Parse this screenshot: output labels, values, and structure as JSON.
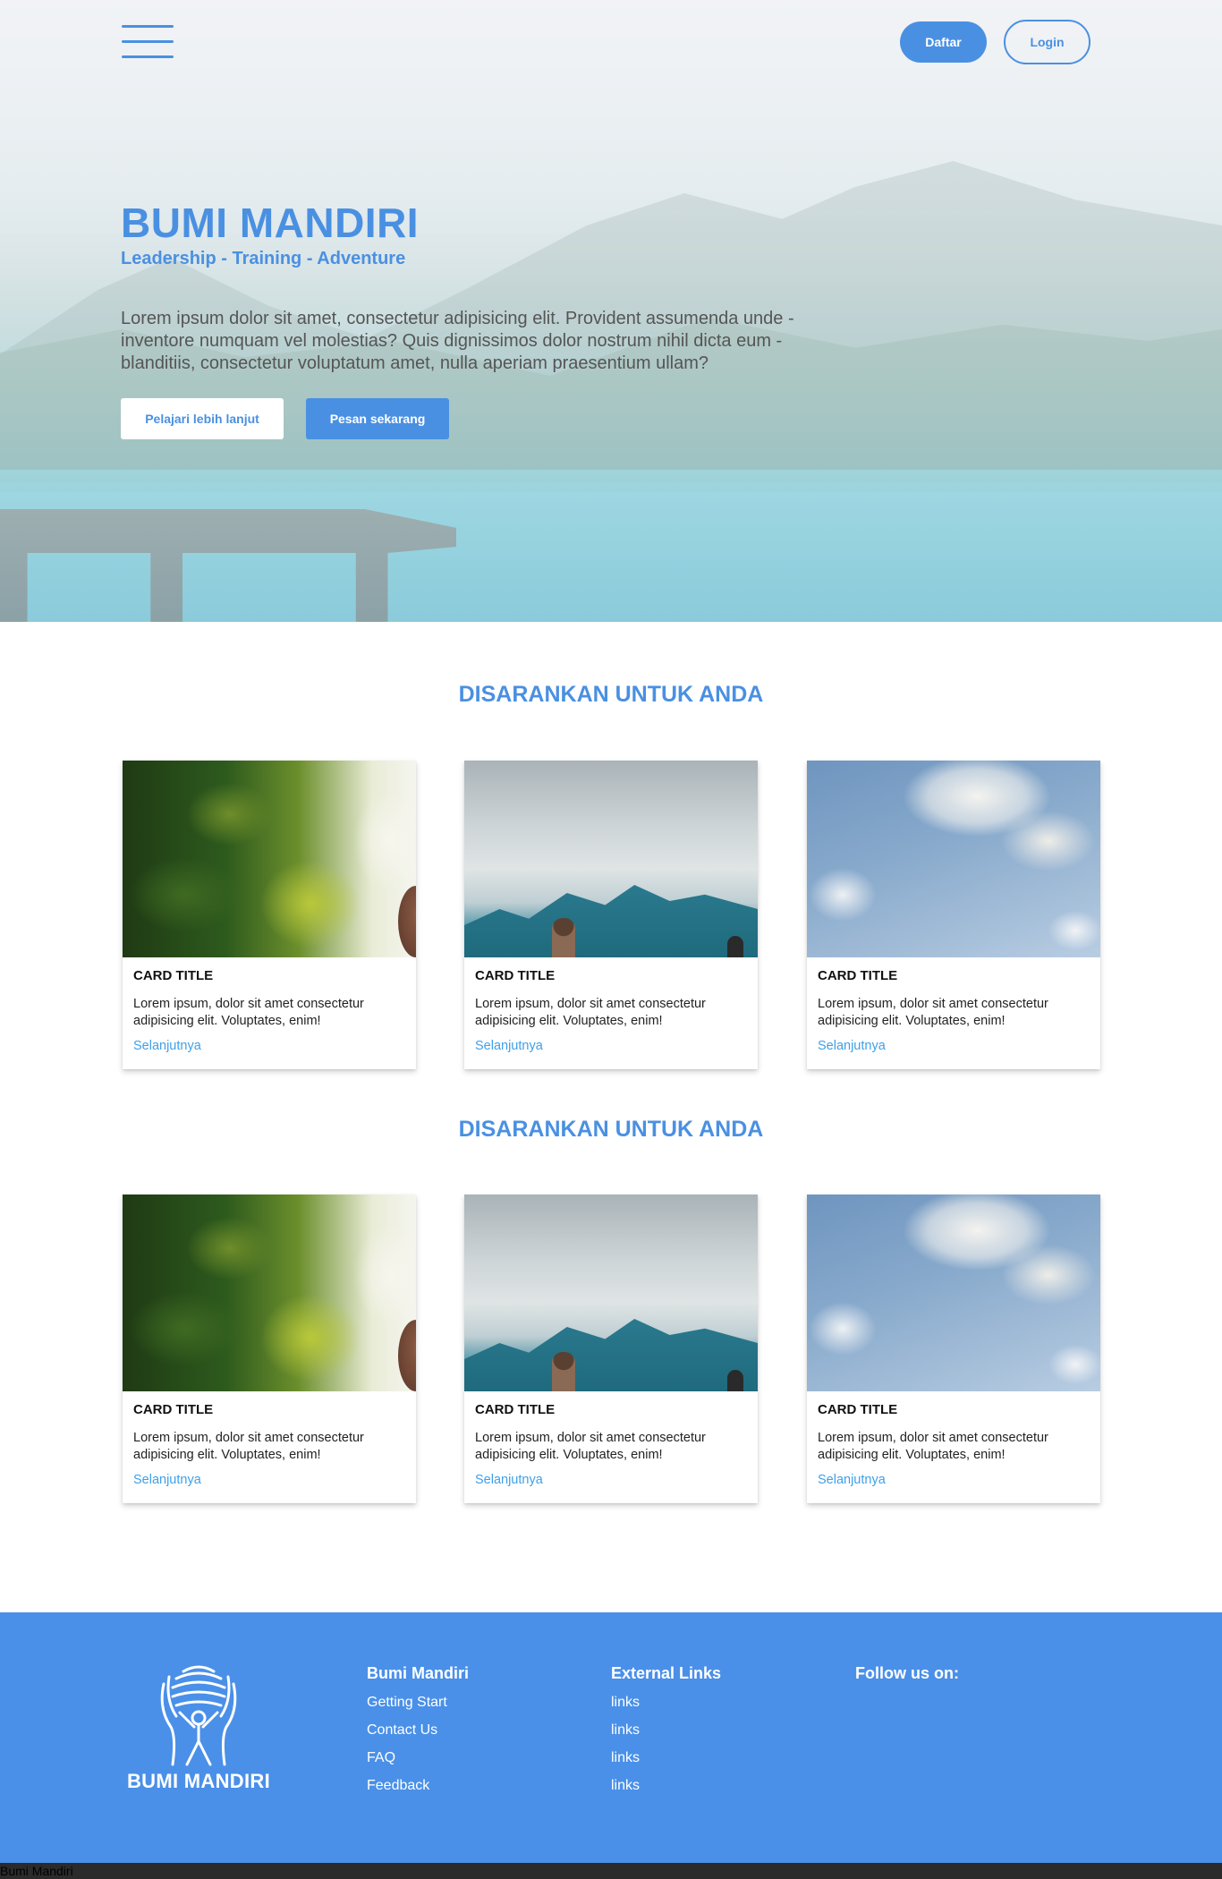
{
  "header": {
    "menu_icon": "hamburger-icon",
    "register_label": "Daftar",
    "login_label": "Login"
  },
  "hero": {
    "title": "BUMI MANDIRI",
    "tagline": "Leadership - Training - Adventure",
    "description": "Lorem ipsum dolor sit amet, consectetur adipisicing elit. Provident assumenda unde - inventore numquam vel molestias? Quis dignissimos dolor nostrum nihil dicta eum - blanditiis, consectetur voluptatum amet, nulla aperiam praesentium ullam?",
    "learn_more_label": "Pelajari lebih lanjut",
    "order_now_label": "Pesan sekarang"
  },
  "sections": [
    {
      "title": "DISARANKAN UNTUK ANDA",
      "cards": [
        {
          "image": "forest-photo",
          "title": "CARD TITLE",
          "text": "Lorem ipsum, dolor sit amet consectetur adipisicing elit. Voluptates, enim!",
          "link": "Selanjutnya"
        },
        {
          "image": "mountain-photo",
          "title": "CARD TITLE",
          "text": "Lorem ipsum, dolor sit amet consectetur adipisicing elit. Voluptates, enim!",
          "link": "Selanjutnya"
        },
        {
          "image": "sky-photo",
          "title": "CARD TITLE",
          "text": "Lorem ipsum, dolor sit amet consectetur adipisicing elit. Voluptates, enim!",
          "link": "Selanjutnya"
        }
      ]
    },
    {
      "title": "DISARANKAN UNTUK ANDA",
      "cards": [
        {
          "image": "forest-photo",
          "title": "CARD TITLE",
          "text": "Lorem ipsum, dolor sit amet consectetur adipisicing elit. Voluptates, enim!",
          "link": "Selanjutnya"
        },
        {
          "image": "mountain-photo",
          "title": "CARD TITLE",
          "text": "Lorem ipsum, dolor sit amet consectetur adipisicing elit. Voluptates, enim!",
          "link": "Selanjutnya"
        },
        {
          "image": "sky-photo",
          "title": "CARD TITLE",
          "text": "Lorem ipsum, dolor sit amet consectetur adipisicing elit. Voluptates, enim!",
          "link": "Selanjutnya"
        }
      ]
    }
  ],
  "footer": {
    "logo_text": "BUMI MANDIRI",
    "columns": [
      {
        "heading": "Bumi Mandiri",
        "links": [
          "Getting Start",
          "Contact Us",
          "FAQ",
          "Feedback"
        ]
      },
      {
        "heading": "External Links",
        "links": [
          "links",
          "links",
          "links",
          "links"
        ]
      },
      {
        "heading": "Follow us on:",
        "links": []
      }
    ]
  },
  "status_bar": {
    "text": "Bumi Mandiri"
  },
  "colors": {
    "accent": "#4a90e2",
    "footer_bg": "#4a90e8",
    "link": "#3fa0e8",
    "bottom_bar": "#2b2b2b"
  }
}
